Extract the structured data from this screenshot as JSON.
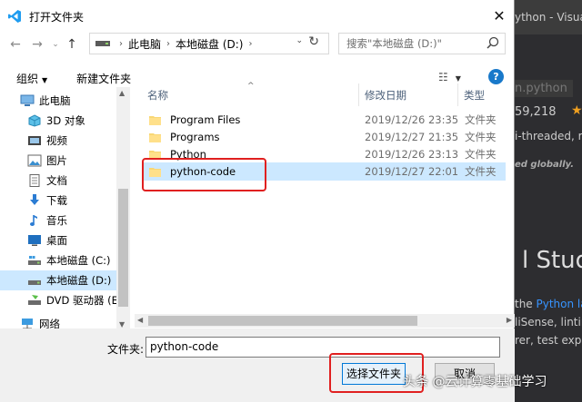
{
  "background_app": {
    "window_title": "ython - Visual S",
    "package_id": "n.python",
    "installs": "59,218",
    "description_fragment": "i-threaded, re",
    "global_note": "ed globally.",
    "heading_fragment": "l Studio",
    "line1_prefix": "the ",
    "line1_link": "Python lar",
    "line2": "liSense, linting",
    "line3": "rer, test explo"
  },
  "dialog": {
    "title": "打开文件夹",
    "address": {
      "segments": [
        "此电脑",
        "本地磁盘 (D:)"
      ]
    },
    "search_placeholder": "搜索\"本地磁盘 (D:)\"",
    "toolbar": {
      "organize": "组织",
      "new_folder": "新建文件夹"
    },
    "tree": [
      {
        "label": "此电脑",
        "icon": "computer-icon",
        "selected": false
      },
      {
        "label": "3D 对象",
        "icon": "cube-icon",
        "selected": false
      },
      {
        "label": "视频",
        "icon": "video-icon",
        "selected": false
      },
      {
        "label": "图片",
        "icon": "picture-icon",
        "selected": false
      },
      {
        "label": "文档",
        "icon": "document-icon",
        "selected": false
      },
      {
        "label": "下载",
        "icon": "download-icon",
        "selected": false
      },
      {
        "label": "音乐",
        "icon": "music-icon",
        "selected": false
      },
      {
        "label": "桌面",
        "icon": "desktop-icon",
        "selected": false
      },
      {
        "label": "本地磁盘 (C:)",
        "icon": "drive-c-icon",
        "selected": false
      },
      {
        "label": "本地磁盘 (D:)",
        "icon": "drive-d-icon",
        "selected": true
      },
      {
        "label": "DVD 驱动器 (E:)",
        "icon": "dvd-icon",
        "selected": false
      },
      {
        "label": "网络",
        "icon": "network-icon",
        "selected": false
      }
    ],
    "columns": {
      "name": "名称",
      "modified": "修改日期",
      "type": "类型"
    },
    "files": [
      {
        "name": "Program Files",
        "modified": "2019/12/26 23:35",
        "type": "文件夹",
        "selected": false
      },
      {
        "name": "Programs",
        "modified": "2019/12/27 21:35",
        "type": "文件夹",
        "selected": false
      },
      {
        "name": "Python",
        "modified": "2019/12/26 23:13",
        "type": "文件夹",
        "selected": false
      },
      {
        "name": "python-code",
        "modified": "2019/12/27 22:01",
        "type": "文件夹",
        "selected": true
      }
    ],
    "folder_label": "文件夹:",
    "folder_value": "python-code",
    "select_button": "选择文件夹",
    "cancel_button": "取消"
  },
  "watermark": "头条 @云计算零基础学习",
  "colors": {
    "selection": "#cce8ff",
    "highlight_box": "#e02020",
    "folder": "#f8d775",
    "accent": "#0078d7"
  }
}
